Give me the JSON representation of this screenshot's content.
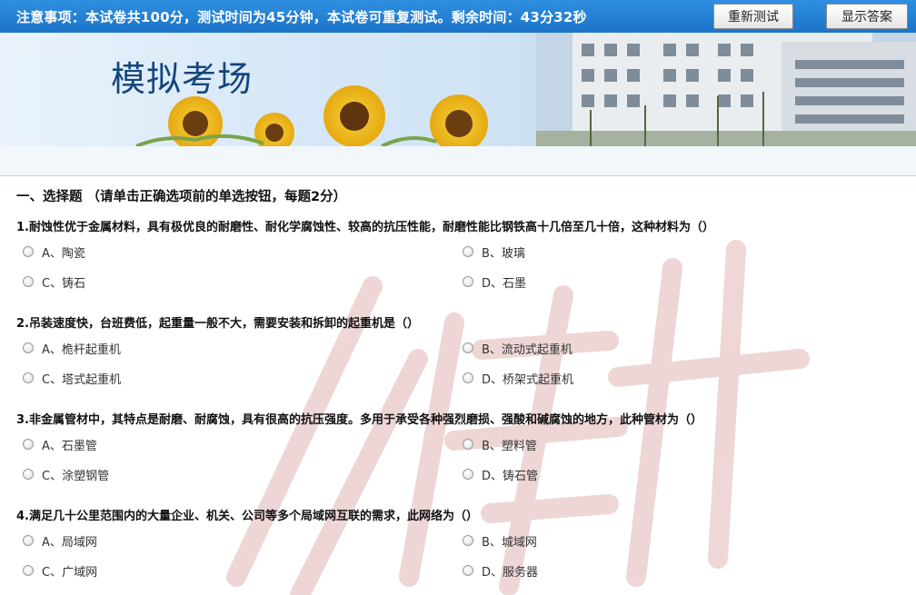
{
  "topbar": {
    "notice": "注意事项：本试卷共100分，测试时间为45分钟，本试卷可重复测试。剩余时间：43分32秒",
    "retest_label": "重新测试",
    "show_answer_label": "显示答案"
  },
  "banner": {
    "title": "模拟考场"
  },
  "section": {
    "title": "一、选择题 （请单击正确选项前的单选按钮，每题2分）"
  },
  "questions": [
    {
      "text": "1.耐蚀性优于金属材料，具有极优良的耐磨性、耐化学腐蚀性、较高的抗压性能，耐磨性能比钢铁高十几倍至几十倍，这种材料为（）",
      "options": [
        "A、陶瓷",
        "B、玻璃",
        "C、铸石",
        "D、石墨"
      ]
    },
    {
      "text": "2.吊装速度快，台班费低，起重量一般不大，需要安装和拆卸的起重机是（）",
      "options": [
        "A、桅杆起重机",
        "B、流动式起重机",
        "C、塔式起重机",
        "D、桥架式起重机"
      ]
    },
    {
      "text": "3.非金属管材中，其特点是耐磨、耐腐蚀，具有很高的抗压强度。多用于承受各种强烈磨损、强酸和碱腐蚀的地方，此种管材为（）",
      "options": [
        "A、石墨管",
        "B、塑料管",
        "C、涂塑钢管",
        "D、铸石管"
      ]
    },
    {
      "text": "4.满足几十公里范围内的大量企业、机关、公司等多个局域网互联的需求，此网络为（）",
      "options": [
        "A、局域网",
        "B、城域网",
        "C、广域网",
        "D、服务器"
      ]
    }
  ]
}
